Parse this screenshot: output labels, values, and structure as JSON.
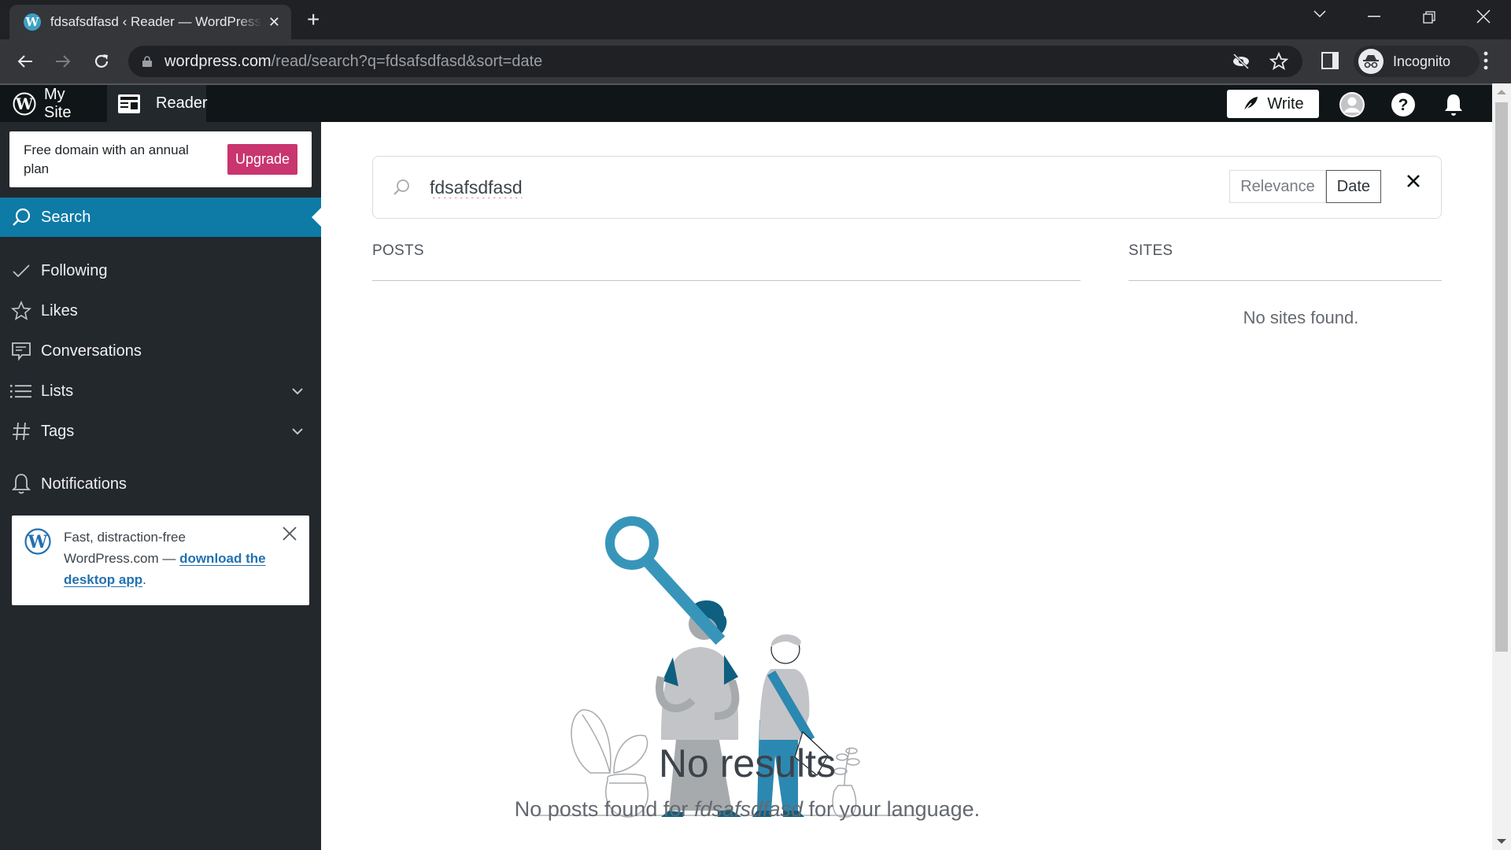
{
  "browser": {
    "tab_title": "fdsafsdfasd ‹ Reader — WordPress.com",
    "url_host": "wordpress.com",
    "url_path": "/read/search?q=fdsafsdfasd&sort=date",
    "profile_label": "Incognito",
    "new_tab_label": "+"
  },
  "masterbar": {
    "my_site_label": "My Site",
    "reader_label": "Reader",
    "write_label": "Write"
  },
  "sidebar": {
    "upgrade_nudge": {
      "text": "Free domain with an annual plan",
      "button_label": "Upgrade"
    },
    "items": [
      {
        "label": "Search",
        "icon": "search-icon",
        "active": true
      },
      {
        "label": "Following",
        "icon": "check-icon"
      },
      {
        "label": "Likes",
        "icon": "star-icon"
      },
      {
        "label": "Conversations",
        "icon": "comment-icon"
      },
      {
        "label": "Lists",
        "icon": "list-icon",
        "expandable": true
      },
      {
        "label": "Tags",
        "icon": "hash-icon",
        "expandable": true
      },
      {
        "label": "Notifications",
        "icon": "bell-icon"
      }
    ],
    "app_promo": {
      "text_before": "Fast, distraction-free WordPress.com — ",
      "link_label": "download the desktop app",
      "text_after": "."
    }
  },
  "search": {
    "query": "fdsafsdfasd",
    "sort_options": [
      "Relevance",
      "Date"
    ],
    "selected_sort": "Date"
  },
  "results": {
    "posts_header": "POSTS",
    "sites_header": "SITES",
    "no_sites_text": "No sites found.",
    "empty_title": "No results",
    "empty_sub_before": "No posts found for ",
    "empty_sub_query": "fdsafsdfasd",
    "empty_sub_after": " for your language."
  },
  "colors": {
    "accent": "#0e7aa6",
    "upgrade": "#c9356e",
    "masterbar": "#101517",
    "sidebar": "#23282d",
    "illustration_blue": "#3895ba",
    "illustration_dark_blue": "#0e5f80"
  }
}
